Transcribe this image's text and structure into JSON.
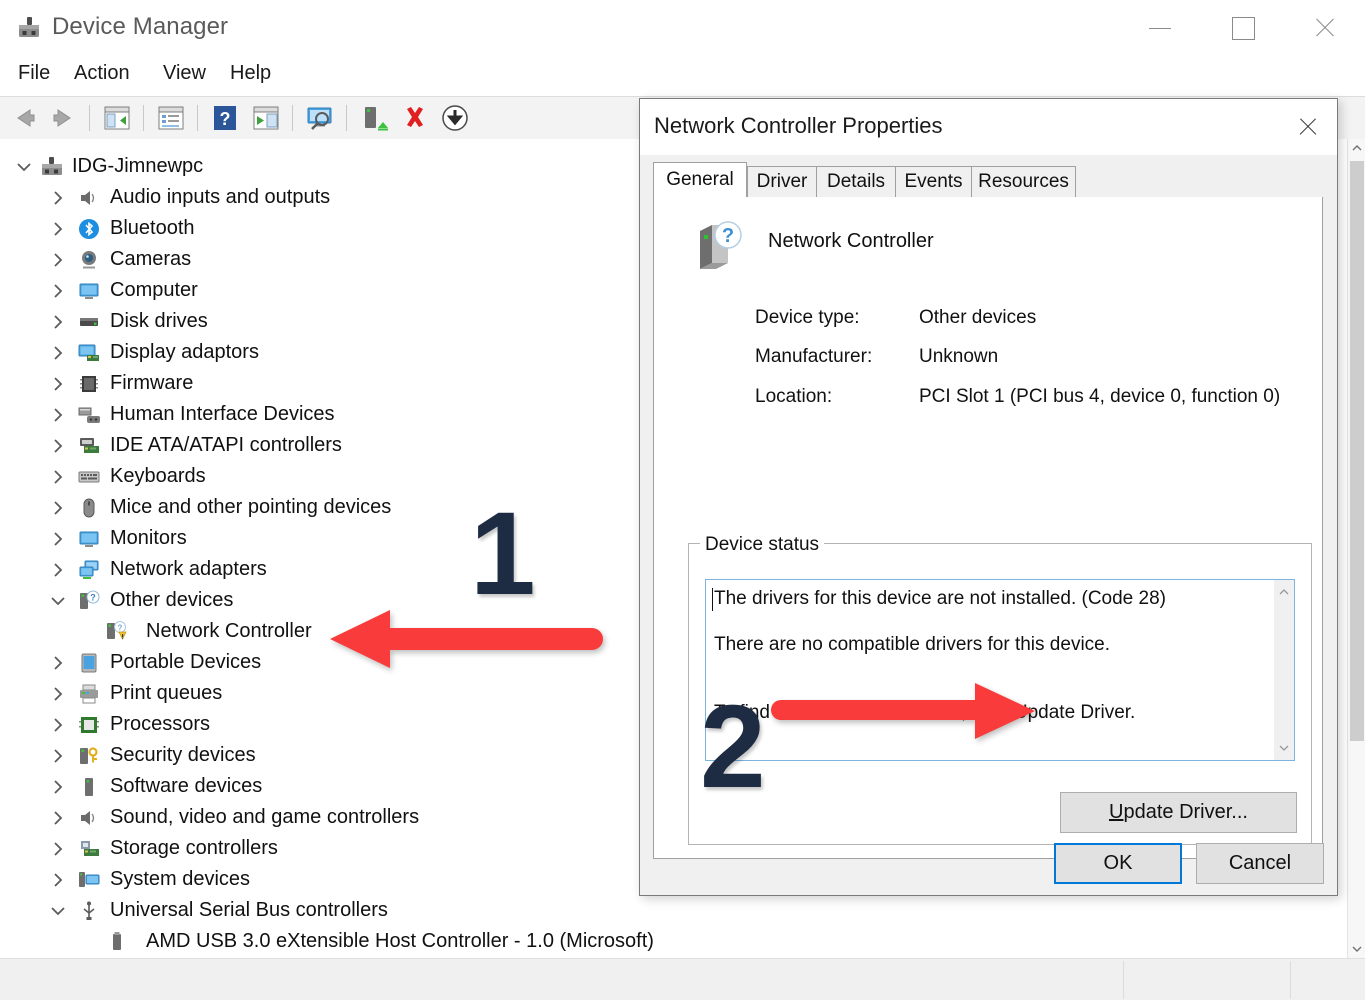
{
  "window": {
    "title": "Device Manager",
    "icon": "device-manager-icon",
    "controls": {
      "minimize": "minimize-icon",
      "maximize": "maximize-icon",
      "close": "close-icon"
    }
  },
  "menubar": {
    "items": [
      "File",
      "Action",
      "View",
      "Help"
    ]
  },
  "toolbar": {
    "buttons": [
      "back-icon",
      "forward-icon",
      "show-hide-console-tree-icon",
      "properties-icon",
      "help-icon",
      "scan-for-hardware-changes-icon",
      "update-driver-toolbar-icon",
      "uninstall-device-icon",
      "disable-device-icon"
    ]
  },
  "tree": {
    "root": {
      "label": "IDG-Jimnewpc",
      "icon": "computer-root-icon",
      "expanded": true
    },
    "items": [
      {
        "label": "Audio inputs and outputs",
        "icon": "speaker-icon",
        "expanded": false,
        "indent": 1
      },
      {
        "label": "Bluetooth",
        "icon": "bluetooth-icon",
        "expanded": false,
        "indent": 1
      },
      {
        "label": "Cameras",
        "icon": "camera-icon",
        "expanded": false,
        "indent": 1
      },
      {
        "label": "Computer",
        "icon": "monitor-icon",
        "expanded": false,
        "indent": 1
      },
      {
        "label": "Disk drives",
        "icon": "disk-drive-icon",
        "expanded": false,
        "indent": 1
      },
      {
        "label": "Display adaptors",
        "icon": "display-adapter-icon",
        "expanded": false,
        "indent": 1
      },
      {
        "label": "Firmware",
        "icon": "firmware-chip-icon",
        "expanded": false,
        "indent": 1
      },
      {
        "label": "Human Interface Devices",
        "icon": "hid-icon",
        "expanded": false,
        "indent": 1
      },
      {
        "label": "IDE ATA/ATAPI controllers",
        "icon": "ide-controller-icon",
        "expanded": false,
        "indent": 1
      },
      {
        "label": "Keyboards",
        "icon": "keyboard-icon",
        "expanded": false,
        "indent": 1
      },
      {
        "label": "Mice and other pointing devices",
        "icon": "mouse-icon",
        "expanded": false,
        "indent": 1
      },
      {
        "label": "Monitors",
        "icon": "monitor-icon",
        "expanded": false,
        "indent": 1
      },
      {
        "label": "Network adapters",
        "icon": "network-adapter-icon",
        "expanded": false,
        "indent": 1
      },
      {
        "label": "Other devices",
        "icon": "other-devices-icon",
        "expanded": true,
        "indent": 1
      },
      {
        "label": "Network Controller",
        "icon": "unknown-device-warning-icon",
        "expanded": null,
        "indent": 2
      },
      {
        "label": "Portable Devices",
        "icon": "portable-device-icon",
        "expanded": false,
        "indent": 1
      },
      {
        "label": "Print queues",
        "icon": "printer-icon",
        "expanded": false,
        "indent": 1
      },
      {
        "label": "Processors",
        "icon": "processor-icon",
        "expanded": false,
        "indent": 1
      },
      {
        "label": "Security devices",
        "icon": "security-device-icon",
        "expanded": false,
        "indent": 1
      },
      {
        "label": "Software devices",
        "icon": "software-device-icon",
        "expanded": false,
        "indent": 1
      },
      {
        "label": "Sound, video and game controllers",
        "icon": "speaker-icon",
        "expanded": false,
        "indent": 1
      },
      {
        "label": "Storage controllers",
        "icon": "storage-controller-icon",
        "expanded": false,
        "indent": 1
      },
      {
        "label": "System devices",
        "icon": "system-device-icon",
        "expanded": false,
        "indent": 1
      },
      {
        "label": "Universal Serial Bus controllers",
        "icon": "usb-icon",
        "expanded": true,
        "indent": 1
      },
      {
        "label": "AMD USB 3.0 eXtensible Host Controller - 1.0 (Microsoft)",
        "icon": "usb-device-icon",
        "expanded": null,
        "indent": 2
      }
    ]
  },
  "dialog": {
    "title": "Network Controller Properties",
    "close_icon": "close-icon",
    "tabs": [
      {
        "label": "General",
        "active": true
      },
      {
        "label": "Driver",
        "active": false
      },
      {
        "label": "Details",
        "active": false
      },
      {
        "label": "Events",
        "active": false
      },
      {
        "label": "Resources",
        "active": false
      }
    ],
    "device": {
      "icon": "unknown-device-icon",
      "name": "Network Controller",
      "fields": [
        {
          "label": "Device type:",
          "value": "Other devices"
        },
        {
          "label": "Manufacturer:",
          "value": "Unknown"
        },
        {
          "label": "Location:",
          "value": "PCI Slot 1 (PCI bus 4, device 0, function 0)"
        }
      ]
    },
    "device_status": {
      "group_title": "Device status",
      "lines": [
        "The drivers for this device are not installed. (Code 28)",
        "There are no compatible drivers for this device.",
        "To find a driver for this device, click Update Driver."
      ],
      "scroll_up_icon": "chevron-up-icon",
      "scroll_down_icon": "chevron-down-icon"
    },
    "buttons": {
      "update_driver_accel": "U",
      "update_driver_rest": "pdate Driver...",
      "ok": "OK",
      "cancel": "Cancel"
    }
  },
  "annotations": {
    "step_one": "1",
    "step_two": "2",
    "arrow_one": "left-arrow-annotation",
    "arrow_two": "right-arrow-annotation",
    "arrow_color": "#f93b3b",
    "number_color": "#1e2c43"
  },
  "statusbar": {
    "text": ""
  }
}
